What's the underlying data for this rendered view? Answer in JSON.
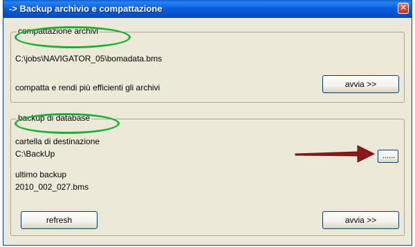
{
  "window": {
    "title": "-> Backup archivio e compattazione",
    "close_glyph": "✕"
  },
  "compaction": {
    "legend": "compattazione archivi",
    "path": "C:\\jobs\\NAVIGATOR_05\\bomadata.bms",
    "description": "compatta e rendi più efficienti gli archivi",
    "run_label": "avvia >>"
  },
  "backup": {
    "legend": "backup di database",
    "destination_label": "cartella di destinazione",
    "destination_value": "C:\\BackUp",
    "browse_label": "......",
    "last_backup_label": "ultimo backup",
    "last_backup_value": "2010_002_027.bms",
    "refresh_label": "refresh",
    "run_label": "avvia >>"
  },
  "annotations": {
    "highlight_color": "#18b233",
    "arrow_color": "#8b1a1a"
  }
}
